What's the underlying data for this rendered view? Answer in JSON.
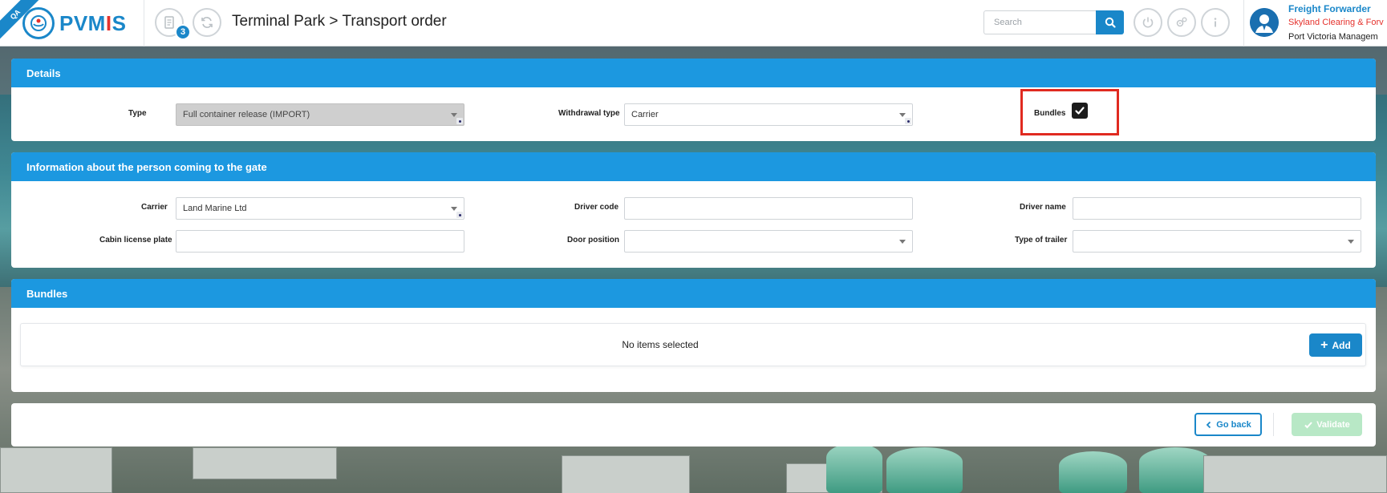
{
  "app": {
    "logo_text_a": "PVM",
    "logo_text_i": "I",
    "logo_text_b": "S",
    "env_ribbon": "QA",
    "notification_count": "3",
    "page_title": "Terminal Park > Transport order"
  },
  "search": {
    "placeholder": "Search",
    "value": ""
  },
  "user": {
    "role": "Freight Forwarder",
    "company": "Skyland Clearing & Forv",
    "organization": "Port Victoria Managem"
  },
  "details": {
    "title": "Details",
    "type_label": "Type",
    "type_value": "Full container release (IMPORT)",
    "withdrawal_label": "Withdrawal type",
    "withdrawal_value": "Carrier",
    "bundles_label": "Bundles",
    "bundles_checked": true
  },
  "person": {
    "title": "Information about the person coming to the gate",
    "carrier_label": "Carrier",
    "carrier_value": "Land Marine Ltd",
    "driver_code_label": "Driver code",
    "driver_code_value": "",
    "driver_name_label": "Driver name",
    "driver_name_value": "",
    "cabin_plate_label": "Cabin license plate",
    "cabin_plate_value": "",
    "door_position_label": "Door position",
    "door_position_value": "",
    "trailer_type_label": "Type of trailer",
    "trailer_type_value": ""
  },
  "bundles": {
    "title": "Bundles",
    "empty_text": "No items selected",
    "add_label": "Add"
  },
  "footer": {
    "go_back_label": "Go back",
    "validate_label": "Validate"
  },
  "colors": {
    "accent": "#1a87c9",
    "panel_header": "#1c98e0",
    "highlight": "#e02a20",
    "validate_disabled": "#b8e8c6",
    "brand_red": "#e5322d"
  }
}
